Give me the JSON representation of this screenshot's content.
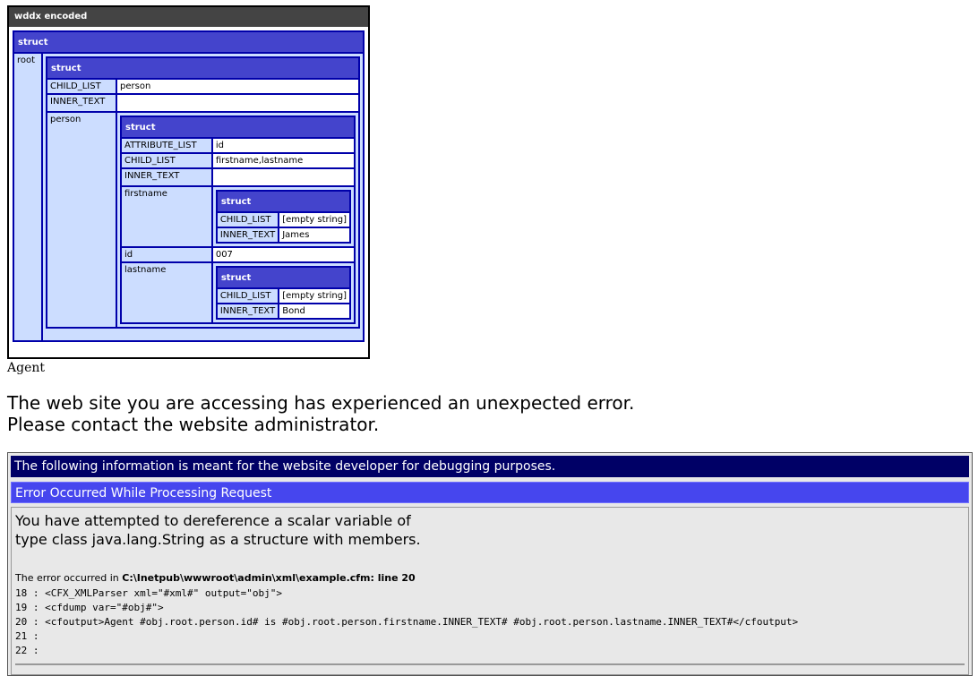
{
  "dump": {
    "title": "wddx encoded",
    "struct_label": "struct",
    "root_key": "root",
    "root_struct": {
      "child_list_key": "CHILD_LIST",
      "child_list_val": "person",
      "inner_text_key": "INNER_TEXT",
      "inner_text_val": "",
      "person_key": "person"
    },
    "person": {
      "attribute_list_key": "ATTRIBUTE_LIST",
      "attribute_list_val": "id",
      "child_list_key": "CHILD_LIST",
      "child_list_val": "firstname,lastname",
      "inner_text_key": "INNER_TEXT",
      "inner_text_val": "",
      "firstname_key": "firstname",
      "id_key": "id",
      "id_val": "007",
      "lastname_key": "lastname"
    },
    "firstname": {
      "child_list_key": "CHILD_LIST",
      "child_list_val": "[empty string]",
      "inner_text_key": "INNER_TEXT",
      "inner_text_val": "James"
    },
    "lastname": {
      "child_list_key": "CHILD_LIST",
      "child_list_val": "[empty string]",
      "inner_text_key": "INNER_TEXT",
      "inner_text_val": "Bond"
    }
  },
  "agent_text": "Agent",
  "message": {
    "line1": "The web site you are accessing has experienced an unexpected error.",
    "line2": "Please contact the website administrator."
  },
  "error": {
    "debug_notice": "The following information is meant for the website developer for debugging purposes.",
    "header": "Error Occurred While Processing Request",
    "message_line1": "You have attempted to dereference a scalar variable of",
    "message_line2": "type class java.lang.String as a structure with members.",
    "location_prefix": "The error occurred in ",
    "location_path": "C:\\Inetpub\\wwwroot\\admin\\xml\\example.cfm: line 20",
    "code_lines": [
      "18 : <CFX_XMLParser xml=\"#xml#\" output=\"obj\">",
      "19 : <cfdump var=\"#obj#\">",
      "20 : <cfoutput>Agent #obj.root.person.id# is #obj.root.person.firstname.INNER_TEXT# #obj.root.person.lastname.INNER_TEXT#</cfoutput>",
      "21 :",
      "22 :"
    ]
  },
  "colors": {
    "dump_header": "#444444",
    "struct_header": "#4444cc",
    "struct_border": "#0000aa",
    "key_cell": "#ccddff",
    "error_bar_dark": "#000066",
    "error_bar_blue": "#4646ee"
  }
}
